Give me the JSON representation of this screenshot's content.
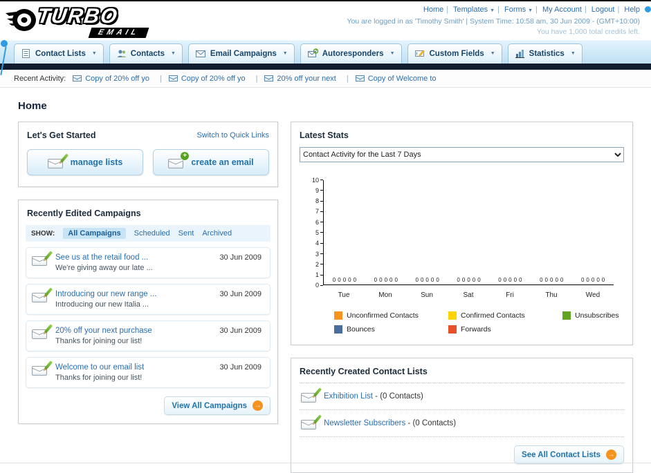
{
  "header": {
    "logo": {
      "top": "TURBO",
      "bottom": "EMAIL"
    },
    "nav_links": [
      {
        "label": "Home"
      },
      {
        "label": "Templates"
      },
      {
        "label": "Forms"
      },
      {
        "label": "My Account"
      },
      {
        "label": "Logout"
      },
      {
        "label": "Help"
      }
    ],
    "login_info": "You are logged in as 'Timothy Smith' | System Time: 10:58 am, 30 Jun 2009 - (GMT+10:00)",
    "credits_info": "You have 1,000 total credits left."
  },
  "nav_tabs": [
    {
      "label": "Contact Lists",
      "icon": "contact-lists-icon"
    },
    {
      "label": "Contacts",
      "icon": "contacts-icon"
    },
    {
      "label": "Email Campaigns",
      "icon": "email-campaigns-icon"
    },
    {
      "label": "Autoresponders",
      "icon": "autoresponders-icon"
    },
    {
      "label": "Custom Fields",
      "icon": "custom-fields-icon"
    },
    {
      "label": "Statistics",
      "icon": "statistics-icon"
    }
  ],
  "recent_activity": {
    "label": "Recent Activity:",
    "items": [
      "Copy of 20% off yo",
      "Copy of 20% off yo",
      "20% off your next",
      "Copy of Welcome to"
    ]
  },
  "main": {
    "page_title": "Home"
  },
  "get_started": {
    "title": "Let's Get Started",
    "switch_link": "Switch to Quick Links",
    "manage_lists_label": "manage lists",
    "create_email_label": "create an email"
  },
  "campaigns": {
    "title": "Recently Edited Campaigns",
    "show_label": "SHOW:",
    "filters": [
      "All Campaigns",
      "Scheduled",
      "Sent",
      "Archived"
    ],
    "items": [
      {
        "title": "See us at the retail food ...",
        "subtitle": "We're giving away our late ...",
        "date": "30 Jun 2009"
      },
      {
        "title": "Introducing our new range ...",
        "subtitle": "Introducing our new Italia ...",
        "date": "30 Jun 2009"
      },
      {
        "title": "20% off your next purchase",
        "subtitle": "Thanks for joining our list!",
        "date": "30 Jun 2009"
      },
      {
        "title": "Welcome to our email list",
        "subtitle": "Thanks for joining our list!",
        "date": "30 Jun 2009"
      }
    ],
    "view_all_label": "View All Campaigns"
  },
  "latest_stats": {
    "title": "Latest Stats",
    "range_selected": "Contact Activity for the Last 7 Days",
    "chart_data": {
      "type": "bar",
      "title": "Contact Activity for the Last 7 Days",
      "categories": [
        "Tue",
        "Mon",
        "Sun",
        "Sat",
        "Fri",
        "Thu",
        "Wed"
      ],
      "series": [
        {
          "name": "Unconfirmed Contacts",
          "color": "#f7941d",
          "values": [
            0,
            0,
            0,
            0,
            0,
            0,
            0
          ]
        },
        {
          "name": "Confirmed Contacts",
          "color": "#ffd400",
          "values": [
            0,
            0,
            0,
            0,
            0,
            0,
            0
          ]
        },
        {
          "name": "Unsubscribes",
          "color": "#61a521",
          "values": [
            0,
            0,
            0,
            0,
            0,
            0,
            0
          ]
        },
        {
          "name": "Bounces",
          "color": "#4a6d9e",
          "values": [
            0,
            0,
            0,
            0,
            0,
            0,
            0
          ]
        },
        {
          "name": "Forwards",
          "color": "#e8502a",
          "values": [
            0,
            0,
            0,
            0,
            0,
            0,
            0
          ]
        }
      ],
      "ylim": [
        0,
        10
      ],
      "y_ticks": [
        0,
        1,
        2,
        3,
        4,
        5,
        6,
        7,
        8,
        9,
        10
      ],
      "value_labels": true,
      "grid": false,
      "legend_position": "bottom"
    }
  },
  "contact_lists": {
    "title": "Recently Created Contact Lists",
    "items": [
      {
        "name": "Exhibition List",
        "suffix": " - (0 Contacts)"
      },
      {
        "name": "Newsletter Subscribers",
        "suffix": " - (0 Contacts)"
      }
    ],
    "see_all_label": "See All Contact Lists"
  }
}
